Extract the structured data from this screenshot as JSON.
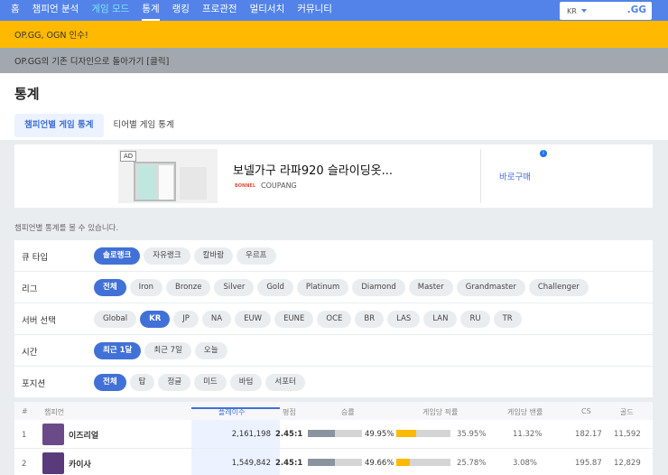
{
  "nav": {
    "items": [
      {
        "label": "홈",
        "state": "normal"
      },
      {
        "label": "챔피언 분석",
        "state": "normal"
      },
      {
        "label": "게임 모드",
        "state": "highlight"
      },
      {
        "label": "통계",
        "state": "active"
      },
      {
        "label": "랭킹",
        "state": "normal"
      },
      {
        "label": "프로관전",
        "state": "normal"
      },
      {
        "label": "멀티서치",
        "state": "normal"
      },
      {
        "label": "커뮤니티",
        "state": "normal"
      }
    ],
    "region": "KR",
    "logo": ".GG"
  },
  "banners": {
    "notice": "OP.GG, OGN 인수!",
    "legacy": "OP.GG의 기존 디자인으로 돌아가기 [클릭]"
  },
  "page": {
    "title": "통계",
    "tabs": [
      "챔피언별 게임 통계",
      "티어별 게임 통계"
    ],
    "description": "챔피언별 통계를 볼 수 있습니다."
  },
  "ad": {
    "tag": "AD",
    "title": "보넬가구 라파920 슬라이딩옷...",
    "brand_logo": "BONNEL",
    "brand": "COUPANG",
    "cta": "바로구매",
    "info": "i"
  },
  "filters": [
    {
      "label": "큐 타입",
      "name": "queue",
      "options": [
        "솔로랭크",
        "자유랭크",
        "칼바람",
        "우르프"
      ],
      "selected": 0
    },
    {
      "label": "리그",
      "name": "league",
      "options": [
        "전체",
        "Iron",
        "Bronze",
        "Silver",
        "Gold",
        "Platinum",
        "Diamond",
        "Master",
        "Grandmaster",
        "Challenger"
      ],
      "selected": 0
    },
    {
      "label": "서버 선택",
      "name": "server",
      "options": [
        "Global",
        "KR",
        "JP",
        "NA",
        "EUW",
        "EUNE",
        "OCE",
        "BR",
        "LAS",
        "LAN",
        "RU",
        "TR"
      ],
      "selected": 1
    },
    {
      "label": "시간",
      "name": "period",
      "options": [
        "최근 1달",
        "최근 7일",
        "오늘"
      ],
      "selected": 0
    },
    {
      "label": "포지션",
      "name": "position",
      "options": [
        "전체",
        "탑",
        "정글",
        "미드",
        "바텀",
        "서포터"
      ],
      "selected": 0
    }
  ],
  "table": {
    "headers": {
      "rank": "#",
      "champion": "챔피언",
      "plays": "플레이수",
      "kda": "평점",
      "winrate": "승률",
      "banrate": "게임당 픽률",
      "pickrate": "게임당 밴률",
      "cs": "CS",
      "gold": "골드"
    },
    "rows": [
      {
        "rank": "1",
        "champion": "이즈리얼",
        "plays": "2,161,198",
        "kda": "2.45:1",
        "winrate": "49.95%",
        "win_frac": 0.4995,
        "banrate": "35.95%",
        "ban_frac": 0.3595,
        "pickrate": "11.32%",
        "cs": "182.17",
        "gold": "11,592",
        "color": "#6b4a8a"
      },
      {
        "rank": "2",
        "champion": "카이사",
        "plays": "1,549,842",
        "kda": "2.45:1",
        "winrate": "49.66%",
        "win_frac": 0.4966,
        "banrate": "25.78%",
        "ban_frac": 0.2578,
        "pickrate": "3.08%",
        "cs": "195.87",
        "gold": "12,829",
        "color": "#5a3a7a"
      }
    ]
  }
}
